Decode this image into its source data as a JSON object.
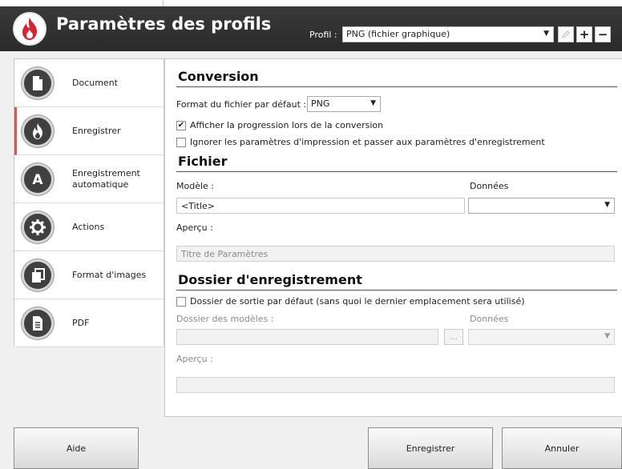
{
  "header": {
    "title": "Paramètres des profils",
    "profile_label": "Profil :",
    "profile_value": "PNG (fichier graphique)",
    "buttons": {
      "rename_icon": "pencil-icon",
      "add": "+",
      "remove": "−"
    }
  },
  "sidebar": {
    "items": [
      {
        "label": "Document",
        "icon": "document-icon"
      },
      {
        "label": "Enregistrer",
        "icon": "flame-icon",
        "selected": true
      },
      {
        "label": "Enregistrement automatique",
        "icon": "letter-a-icon"
      },
      {
        "label": "Actions",
        "icon": "gear-icon"
      },
      {
        "label": "Format d'images",
        "icon": "images-icon"
      },
      {
        "label": "PDF",
        "icon": "pdf-document-icon"
      }
    ]
  },
  "conversion": {
    "title": "Conversion",
    "format_label": "Format du fichier par défaut :",
    "format_value": "PNG",
    "show_progress_label": "Afficher la progression lors de la conversion",
    "show_progress_checked": true,
    "skip_print_label": "Ignorer les paramètres d'impression et passer aux paramètres d'enregistrement",
    "skip_print_checked": false
  },
  "fichier": {
    "title": "Fichier",
    "model_label": "Modèle :",
    "model_value": "<Title>",
    "data_label": "Données",
    "preview_label": "Aperçu :",
    "preview_value": "Titre de Paramètres"
  },
  "dossier": {
    "title": "Dossier d'enregistrement",
    "default_folder_label": "Dossier de sortie par défaut (sans quoi le dernier emplacement sera utilisé)",
    "default_folder_checked": false,
    "models_folder_label": "Dossier des modèles :",
    "browse_label": "...",
    "data_label": "Données",
    "preview_label": "Aperçu :"
  },
  "footer": {
    "help": "Aide",
    "save": "Enregistrer",
    "cancel": "Annuler"
  },
  "colors": {
    "header_bg": "#2e2e2e",
    "accent_red": "#d9534f",
    "logo_flame": "#d9232e"
  }
}
